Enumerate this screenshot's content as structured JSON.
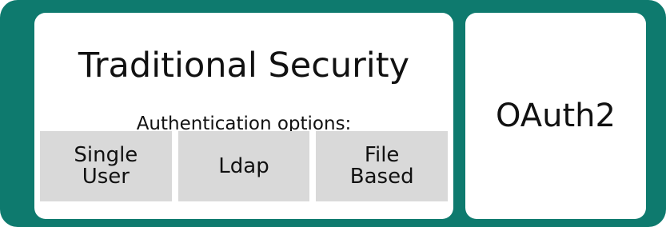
{
  "traditional": {
    "title": "Traditional Security",
    "subtitle": "Authentication options:",
    "options": [
      {
        "label": "Single\nUser"
      },
      {
        "label": "Ldap"
      },
      {
        "label": "File\nBased"
      }
    ]
  },
  "oauth": {
    "label": "OAuth2"
  },
  "colors": {
    "frame": "#0e7a6e",
    "panel": "#ffffff",
    "option_box": "#d9d9d9"
  }
}
